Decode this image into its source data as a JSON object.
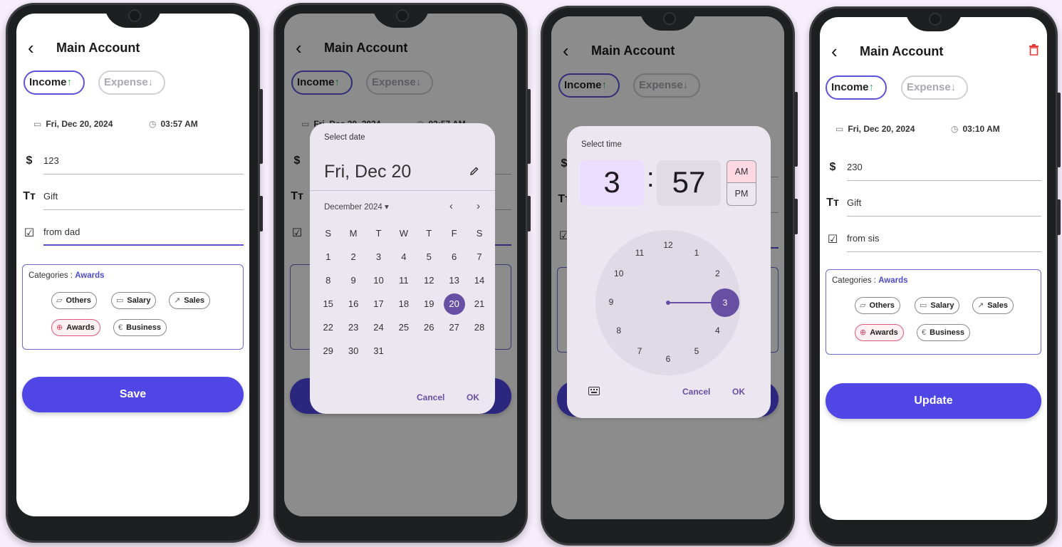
{
  "app": {
    "title": "Main Account"
  },
  "tabs": {
    "income": "Income",
    "expense": "Expense",
    "income_arrow": "↑",
    "expense_arrow": "↓"
  },
  "screens": {
    "s1": {
      "date": "Fri, Dec 20, 2024",
      "time": "03:57 AM",
      "amount": "123",
      "title": "Gift",
      "note": "from dad",
      "categories_label": "Categories : ",
      "selected_category": "Awards",
      "button": "Save"
    },
    "s4": {
      "date": "Fri, Dec 20, 2024",
      "time": "03:10 AM",
      "amount": "230",
      "title": "Gift",
      "note": "from sis",
      "categories_label": "Categories : ",
      "selected_category": "Awards",
      "button": "Update"
    }
  },
  "categories": [
    "Others",
    "Salary",
    "Sales",
    "Awards",
    "Business"
  ],
  "date_picker": {
    "label": "Select date",
    "headline": "Fri, Dec 20",
    "month": "December 2024",
    "weekdays": [
      "S",
      "M",
      "T",
      "W",
      "T",
      "F",
      "S"
    ],
    "weeks": [
      [
        "1",
        "2",
        "3",
        "4",
        "5",
        "6",
        "7"
      ],
      [
        "8",
        "9",
        "10",
        "11",
        "12",
        "13",
        "14"
      ],
      [
        "15",
        "16",
        "17",
        "18",
        "19",
        "20",
        "21"
      ],
      [
        "22",
        "23",
        "24",
        "25",
        "26",
        "27",
        "28"
      ],
      [
        "29",
        "30",
        "31",
        "",
        "",
        "",
        ""
      ]
    ],
    "selected_day": "20",
    "cancel": "Cancel",
    "ok": "OK"
  },
  "time_picker": {
    "label": "Select time",
    "hour": "3",
    "colon": ":",
    "minute": "57",
    "am": "AM",
    "pm": "PM",
    "dial": [
      "12",
      "1",
      "2",
      "3",
      "4",
      "5",
      "6",
      "7",
      "8",
      "9",
      "10",
      "11"
    ],
    "selected_hour": "3",
    "cancel": "Cancel",
    "ok": "OK"
  },
  "colors": {
    "primary": "#4f46e5",
    "picker_accent": "#6750a4",
    "income_green": "#3db35b",
    "delete_red": "#e53935",
    "award_pink": "#e05878"
  },
  "icons": [
    "back-icon",
    "calendar-icon",
    "clock-icon",
    "dollar-icon",
    "text-icon",
    "note-icon",
    "folder-icon",
    "card-icon",
    "trend-icon",
    "globe-icon",
    "euro-icon",
    "trash-icon",
    "pencil-icon",
    "keyboard-icon"
  ]
}
